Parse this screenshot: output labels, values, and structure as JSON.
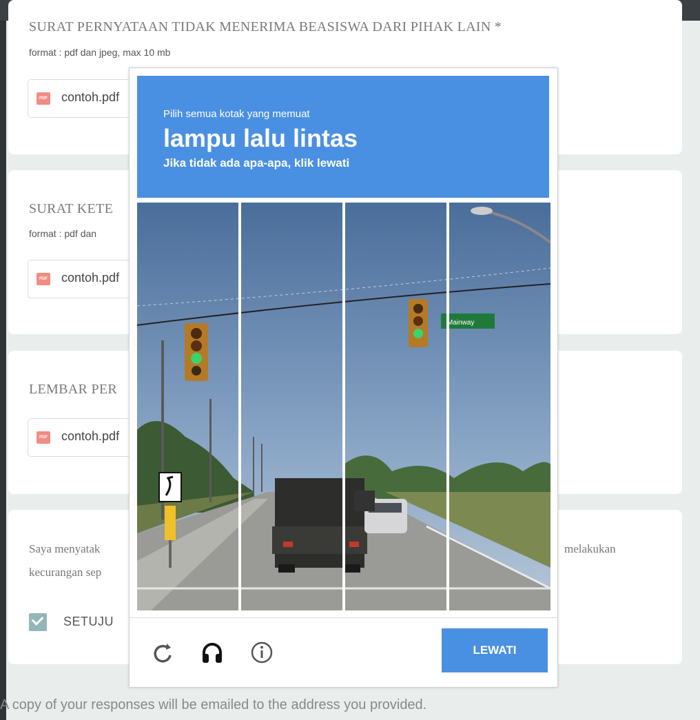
{
  "form": {
    "card1": {
      "title": "SURAT PERNYATAAN TIDAK MENERIMA BEASISWA DARI PIHAK LAIN *",
      "hint": "format : pdf dan jpeg, max 10 mb",
      "file": "contoh.pdf"
    },
    "card2": {
      "title": "SURAT KETE",
      "hint": "format : pdf dan",
      "file": "contoh.pdf"
    },
    "card3": {
      "title": "LEMBAR PER",
      "file": "contoh.pdf"
    },
    "card4": {
      "line1_left": "Saya menyatak",
      "line1_right": "melakukan",
      "line2": "kecurangan sep",
      "checkbox_label": "SETUJU"
    }
  },
  "footer_text": "A copy of your responses will be emailed to the address you provided.",
  "captcha": {
    "instruction": "Pilih semua kotak yang memuat",
    "target": "lampu lalu lintas",
    "subtext": "Jika tidak ada apa-apa, klik lewati",
    "street_sign": "Mainway",
    "skip_label": "LEWATI",
    "icons": [
      "reload-icon",
      "audio-headphones-icon",
      "info-icon"
    ]
  },
  "colors": {
    "accent": "#4a90e2",
    "checkbox": "#93b7b9",
    "pdf_icon": "#f28b82"
  }
}
